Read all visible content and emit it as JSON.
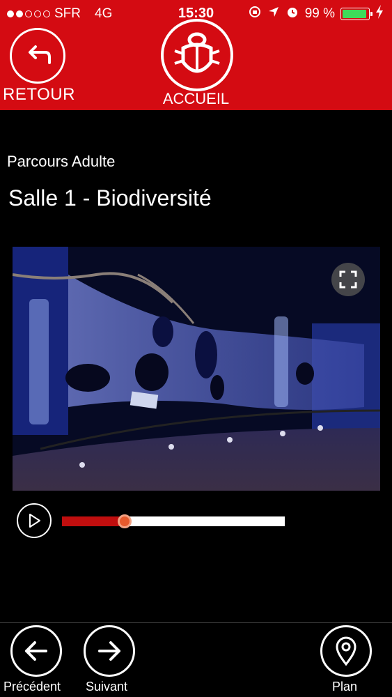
{
  "status_bar": {
    "carrier": "SFR",
    "network": "4G",
    "time": "15:30",
    "battery": "99 %",
    "signal_dots_filled": 2,
    "signal_dots_total": 5
  },
  "header": {
    "back_label": "RETOUR",
    "home_label": "ACCUEIL",
    "background_color": "#d40b12"
  },
  "content": {
    "subtitle": "Parcours Adulte",
    "title": "Salle 1 - Biodiversité"
  },
  "player": {
    "progress_fraction": 0.28,
    "played_color": "#c00e0e"
  },
  "bottom_nav": {
    "previous_label": "Précédent",
    "next_label": "Suivant",
    "map_label": "Plan"
  },
  "icons": [
    "back-arrow-icon",
    "scarab-logo-icon",
    "fullscreen-icon",
    "play-icon",
    "arrow-left-icon",
    "arrow-right-icon",
    "map-pin-icon"
  ]
}
